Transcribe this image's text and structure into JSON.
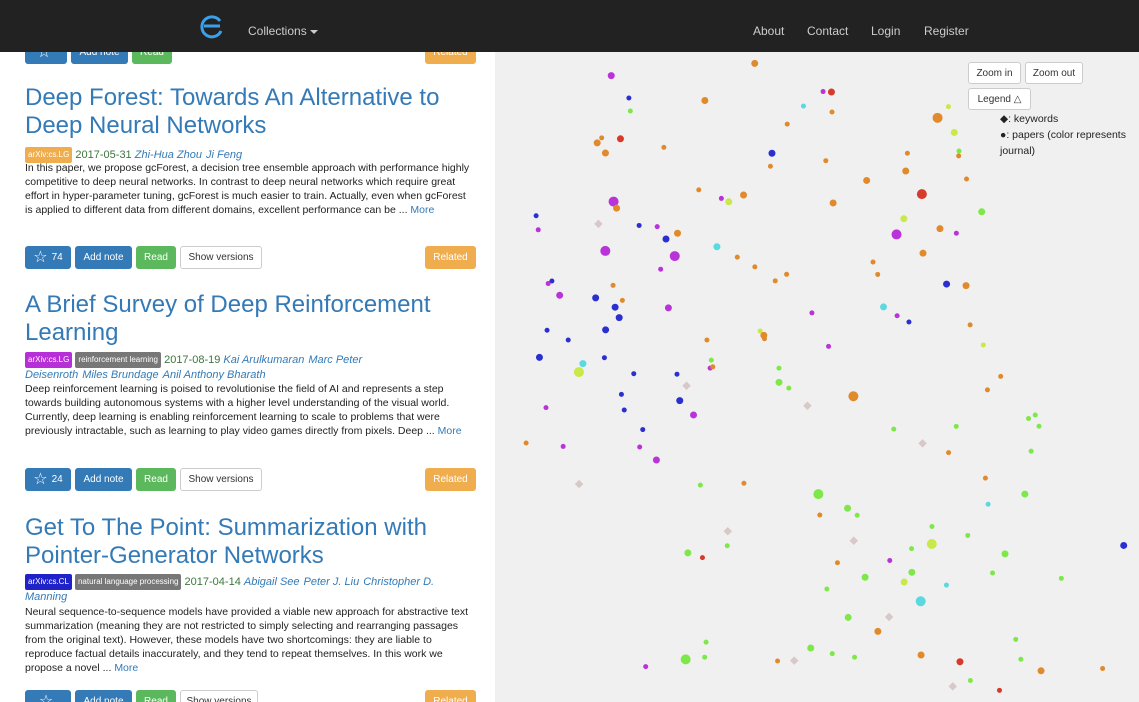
{
  "nav": {
    "collections_label": "Collections",
    "about": "About",
    "contact": "Contact",
    "login": "Login",
    "register": "Register"
  },
  "top_partial": {
    "add_note": "Add note",
    "read": "Read",
    "related": "Related"
  },
  "papers": [
    {
      "title": "Deep Forest: Towards An Alternative to Deep Neural Networks",
      "badges": [
        {
          "text": "arXiv:cs.LG",
          "color": "#f0ad4e"
        }
      ],
      "date": "2017-05-31",
      "authors": [
        "Zhi-Hua Zhou",
        "Ji Feng"
      ],
      "abstract": "In this paper, we propose gcForest, a decision tree ensemble approach with performance highly competitive to deep neural networks. In contrast to deep neural networks which require great effort in hyper-parameter tuning, gcForest is much easier to train. Actually, even when gcForest is applied to different data from different domains, excellent performance can be ...",
      "more": "More",
      "stars": "74",
      "add_note": "Add note",
      "read": "Read",
      "show_versions": "Show versions",
      "related": "Related"
    },
    {
      "title": "A Brief Survey of Deep Reinforcement Learning",
      "badges": [
        {
          "text": "arXiv:cs.LG",
          "color": "#b72fd6"
        },
        {
          "text": "reinforcement learning",
          "color": "#777777"
        }
      ],
      "date": "2017-08-19",
      "authors": [
        "Kai Arulkumaran",
        "Marc Peter Deisenroth",
        "Miles Brundage",
        "Anil Anthony Bharath"
      ],
      "abstract": "Deep reinforcement learning is poised to revolutionise the field of AI and represents a step towards building autonomous systems with a higher level understanding of the visual world. Currently, deep learning is enabling reinforcement learning to scale to problems that were previously intractable, such as learning to play video games directly from pixels. Deep ...",
      "more": "More",
      "stars": "24",
      "add_note": "Add note",
      "read": "Read",
      "show_versions": "Show versions",
      "related": "Related"
    },
    {
      "title": "Get To The Point: Summarization with Pointer-Generator Networks",
      "badges": [
        {
          "text": "arXiv:cs.CL",
          "color": "#1f22c9"
        },
        {
          "text": "natural language processing",
          "color": "#777777"
        }
      ],
      "date": "2017-04-14",
      "authors": [
        "Abigail See",
        "Peter J. Liu",
        "Christopher D. Manning"
      ],
      "abstract": "Neural sequence-to-sequence models have provided a viable new approach for abstractive text summarization (meaning they are not restricted to simply selecting and rearranging passages from the original text). However, these models have two shortcomings: they are liable to reproduce factual details inaccurately, and they tend to repeat themselves. In this work we propose a novel ...",
      "more": "More",
      "add_note": "Add note",
      "read": "Read",
      "show_versions": "Show versions",
      "related": "Related"
    }
  ],
  "map": {
    "zoom_in": "Zoom in",
    "zoom_out": "Zoom out",
    "legend_label": "Legend △",
    "legend_keywords": "◆: keywords",
    "legend_papers": "●: papers (color represents journal)"
  },
  "colors": {
    "navbar": "#222222",
    "link": "#337ab7",
    "date": "#3c763d",
    "map_bg": "#f0f0f0"
  }
}
